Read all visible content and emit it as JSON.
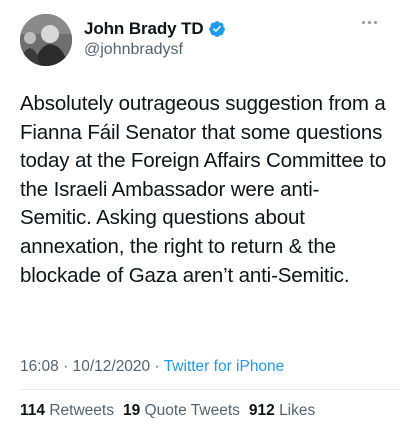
{
  "author": {
    "display_name": "John Brady TD",
    "handle": "@johnbradysf",
    "verified": true,
    "avatar_icon": "profile-photo"
  },
  "tweet": {
    "text": "Absolutely outrageous suggestion from a Fianna Fáil Senator that some questions today at the Foreign Affairs Committee to the Israeli Ambassador were anti-Semitic. Asking questions about annexation, the right to return & the blockade of Gaza aren’t anti-Semitic.",
    "time": "16:08",
    "date": "10/12/2020",
    "source": "Twitter for iPhone"
  },
  "stats": {
    "retweets_count": "114",
    "retweets_label": "Retweets",
    "quote_tweets_count": "19",
    "quote_tweets_label": "Quote Tweets",
    "likes_count": "912",
    "likes_label": "Likes"
  },
  "colors": {
    "accent": "#1d9bf0",
    "text": "#0f1419",
    "secondary": "#536471"
  }
}
